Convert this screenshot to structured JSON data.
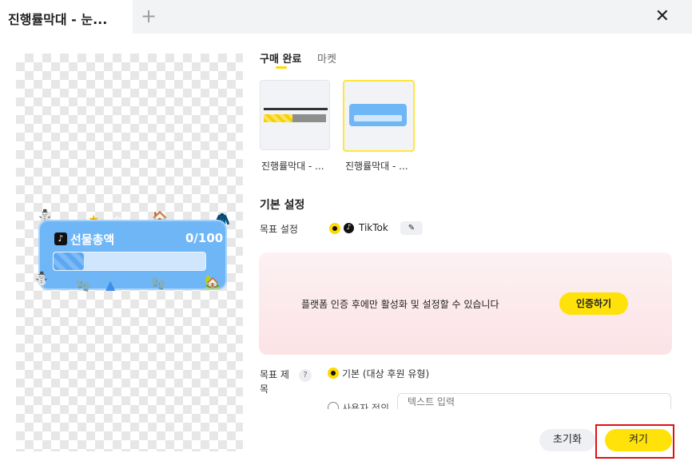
{
  "window": {
    "tab_title": "진행률막대 - 눈...",
    "add_tab_glyph": "+",
    "close_glyph": "✕"
  },
  "preview": {
    "widget_title": "선물총액",
    "widget_count": "0/100",
    "progress": 0.0
  },
  "template_tabs": {
    "purchased": "구매 완료",
    "market": "마켓"
  },
  "templates": [
    {
      "label": "진행률막대 - ..."
    },
    {
      "label": "진행률막대 - ..."
    }
  ],
  "settings": {
    "title": "기본 설정",
    "goal_label": "목표 설정",
    "platform": "TikTok"
  },
  "auth": {
    "message": "플랫폼 인증 후에만 활성화 및 설정할 수 있습니다",
    "button": "인증하기"
  },
  "goal_title": {
    "label": "목표 제목",
    "default_option": "기본 (대상 후원 유형)",
    "custom_option": "사용자 정의",
    "input_placeholder": "텍스트 입력"
  },
  "footer": {
    "reset": "초기화",
    "on": "켜기"
  },
  "colors": {
    "accent": "#ffe20a",
    "highlight": "#e01010",
    "widget_blue": "#6fb6f7"
  }
}
